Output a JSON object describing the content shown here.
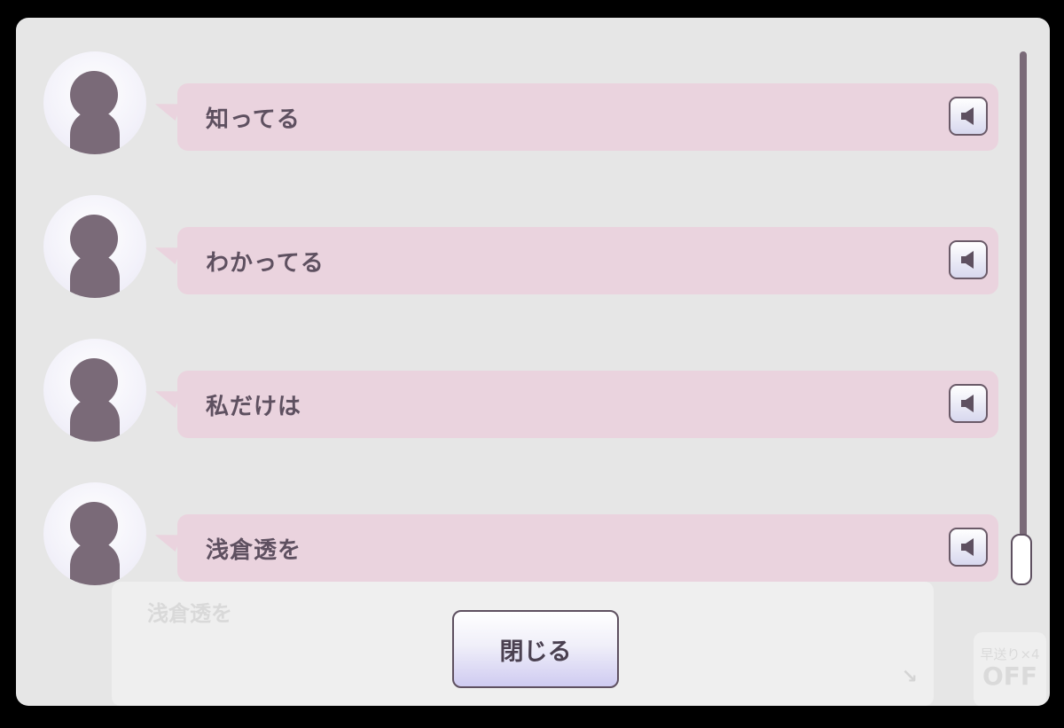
{
  "log": {
    "entries": [
      {
        "text": "知ってる"
      },
      {
        "text": "わかってる"
      },
      {
        "text": "私だけは"
      },
      {
        "text": "浅倉透を"
      }
    ]
  },
  "background_dialog": {
    "text": "浅倉透を",
    "advance_icon": "arrow-down-right-icon"
  },
  "fast_forward": {
    "label": "早送り×4",
    "state": "OFF"
  },
  "close_button": {
    "label": "閉じる"
  },
  "colors": {
    "panel": "#e6e6e6",
    "bubble": "#ead3de",
    "text": "#5e5060",
    "avatar_silhouette": "#7a6a78"
  }
}
